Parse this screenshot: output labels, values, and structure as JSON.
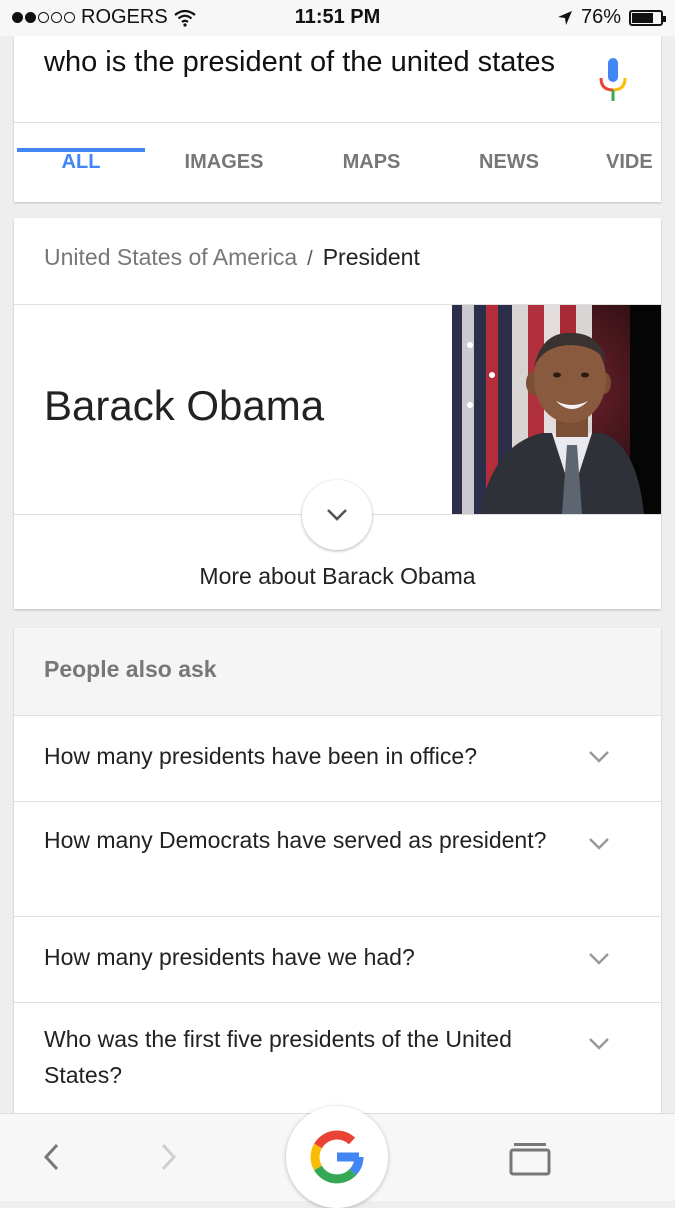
{
  "status_bar": {
    "carrier": "ROGERS",
    "time": "11:51 PM",
    "battery_percent": "76%",
    "battery_level": 0.76,
    "signal_bars_filled": 2,
    "signal_bars_total": 5
  },
  "search": {
    "query": "who is the president of the united states",
    "icon": "mic-icon"
  },
  "tabs": [
    {
      "label": "ALL",
      "active": true
    },
    {
      "label": "IMAGES",
      "active": false
    },
    {
      "label": "MAPS",
      "active": false
    },
    {
      "label": "NEWS",
      "active": false
    },
    {
      "label": "VIDE",
      "active": false
    }
  ],
  "knowledge": {
    "breadcrumb_parent": "United States of America",
    "breadcrumb_separator": "/",
    "breadcrumb_current": "President",
    "name": "Barack Obama",
    "more_label": "More about Barack Obama"
  },
  "people_also_ask": {
    "title": "People also ask",
    "questions": [
      "How many presidents have been in office?",
      "How many Democrats have served as president?",
      "How many presidents have we had?",
      "Who was the first five presidents of the United States?"
    ]
  },
  "colors": {
    "accent": "#4285f4",
    "google_blue": "#4285f4",
    "google_red": "#ea4335",
    "google_yellow": "#fbbc05",
    "google_green": "#34a853"
  }
}
